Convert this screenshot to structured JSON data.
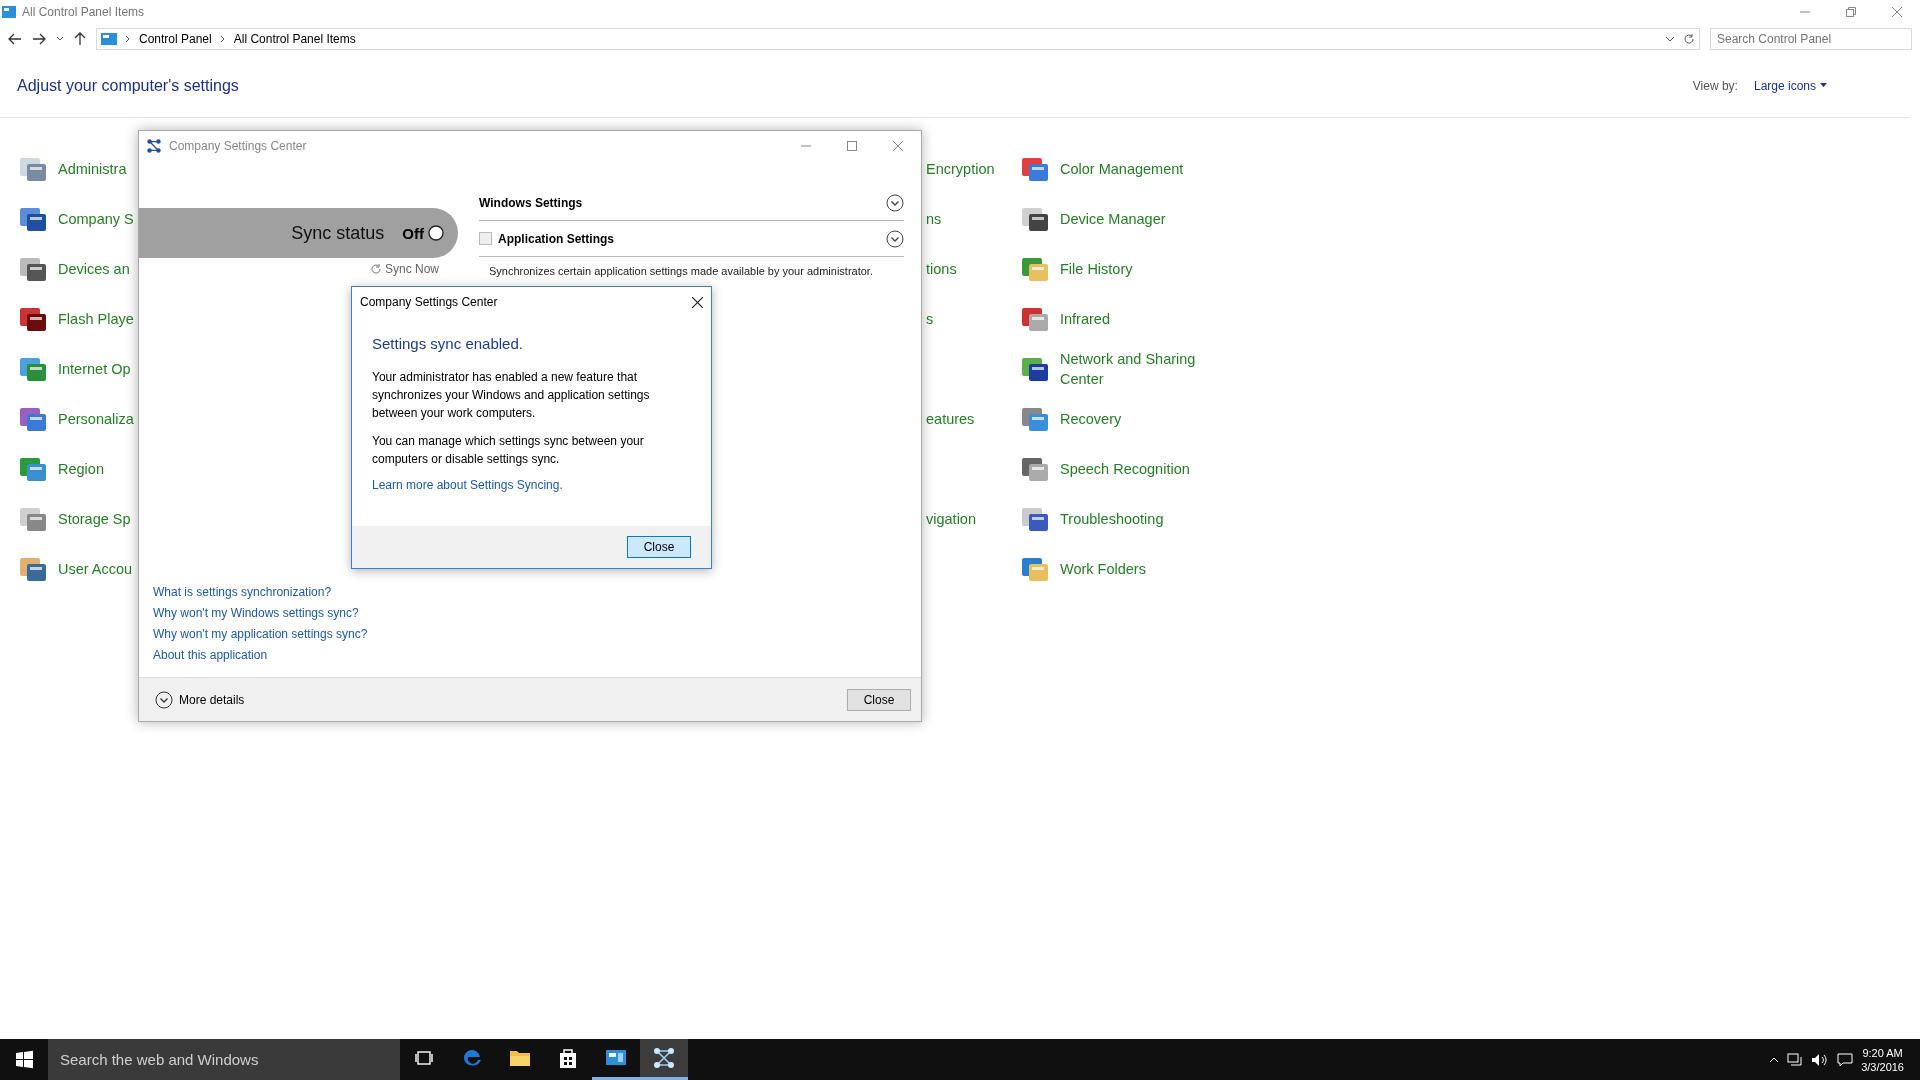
{
  "window": {
    "title": "All Control Panel Items"
  },
  "address_bar": {
    "path": [
      "Control Panel",
      "All Control Panel Items"
    ]
  },
  "search": {
    "placeholder": "Search Control Panel"
  },
  "heading": "Adjust your computer's settings",
  "view_by": {
    "label": "View by:",
    "value": "Large icons"
  },
  "items_left": [
    {
      "label": "Administra"
    },
    {
      "label": "Company S"
    },
    {
      "label": "Devices an"
    },
    {
      "label": "Flash Playe"
    },
    {
      "label": "Internet Op"
    },
    {
      "label": "Personaliza"
    },
    {
      "label": "Region"
    },
    {
      "label": "Storage Sp"
    },
    {
      "label": "User Accou"
    }
  ],
  "items_middle": [
    {
      "kind": "text",
      "label": "Encryption"
    },
    {
      "kind": "text",
      "label": "ns"
    },
    {
      "kind": "text",
      "label": "tions"
    },
    {
      "kind": "text",
      "label": "s"
    },
    {
      "kind": "blank"
    },
    {
      "kind": "text",
      "label": "eatures"
    },
    {
      "kind": "blank"
    },
    {
      "kind": "text",
      "label": "vigation"
    },
    {
      "kind": "blank"
    }
  ],
  "items_right": [
    {
      "label": "Color Management"
    },
    {
      "label": "Device Manager"
    },
    {
      "label": "File History"
    },
    {
      "label": "Infrared"
    },
    {
      "label": "Network and Sharing Center"
    },
    {
      "label": "Recovery"
    },
    {
      "label": "Speech Recognition"
    },
    {
      "label": "Troubleshooting"
    },
    {
      "label": "Work Folders"
    }
  ],
  "settings_window": {
    "title": "Company Settings Center",
    "sync": {
      "label": "Sync status",
      "state_text": "Off",
      "on": false
    },
    "sync_now": "Sync Now",
    "sections": [
      {
        "kind": "header",
        "title": "Windows Settings"
      },
      {
        "kind": "checkbox",
        "title": "Application Settings",
        "checked": false,
        "description": "Synchronizes certain application settings made available by your administrator."
      }
    ],
    "links": [
      "What is settings synchronization?",
      "Why won't my Windows settings sync?",
      "Why won't my application settings sync?",
      "About this application"
    ],
    "more_details": "More details",
    "close": "Close"
  },
  "dialog": {
    "title": "Company Settings Center",
    "heading": "Settings sync enabled.",
    "paragraphs": [
      "Your administrator has enabled a new feature that synchronizes your Windows and application settings between your work computers.",
      "You can manage which settings sync between your computers or disable settings sync."
    ],
    "link": "Learn more about Settings Syncing.",
    "button": "Close"
  },
  "taskbar": {
    "search_placeholder": "Search the web and Windows",
    "apps": [
      {
        "kind": "taskview",
        "selected": false,
        "open": false
      },
      {
        "kind": "edge",
        "selected": false,
        "open": false
      },
      {
        "kind": "explorer",
        "selected": false,
        "open": false
      },
      {
        "kind": "store",
        "selected": false,
        "open": false
      },
      {
        "kind": "controlpanel",
        "selected": false,
        "open": true
      },
      {
        "kind": "company",
        "selected": true,
        "open": true
      }
    ],
    "time": "9:20 AM",
    "date": "3/3/2016"
  }
}
